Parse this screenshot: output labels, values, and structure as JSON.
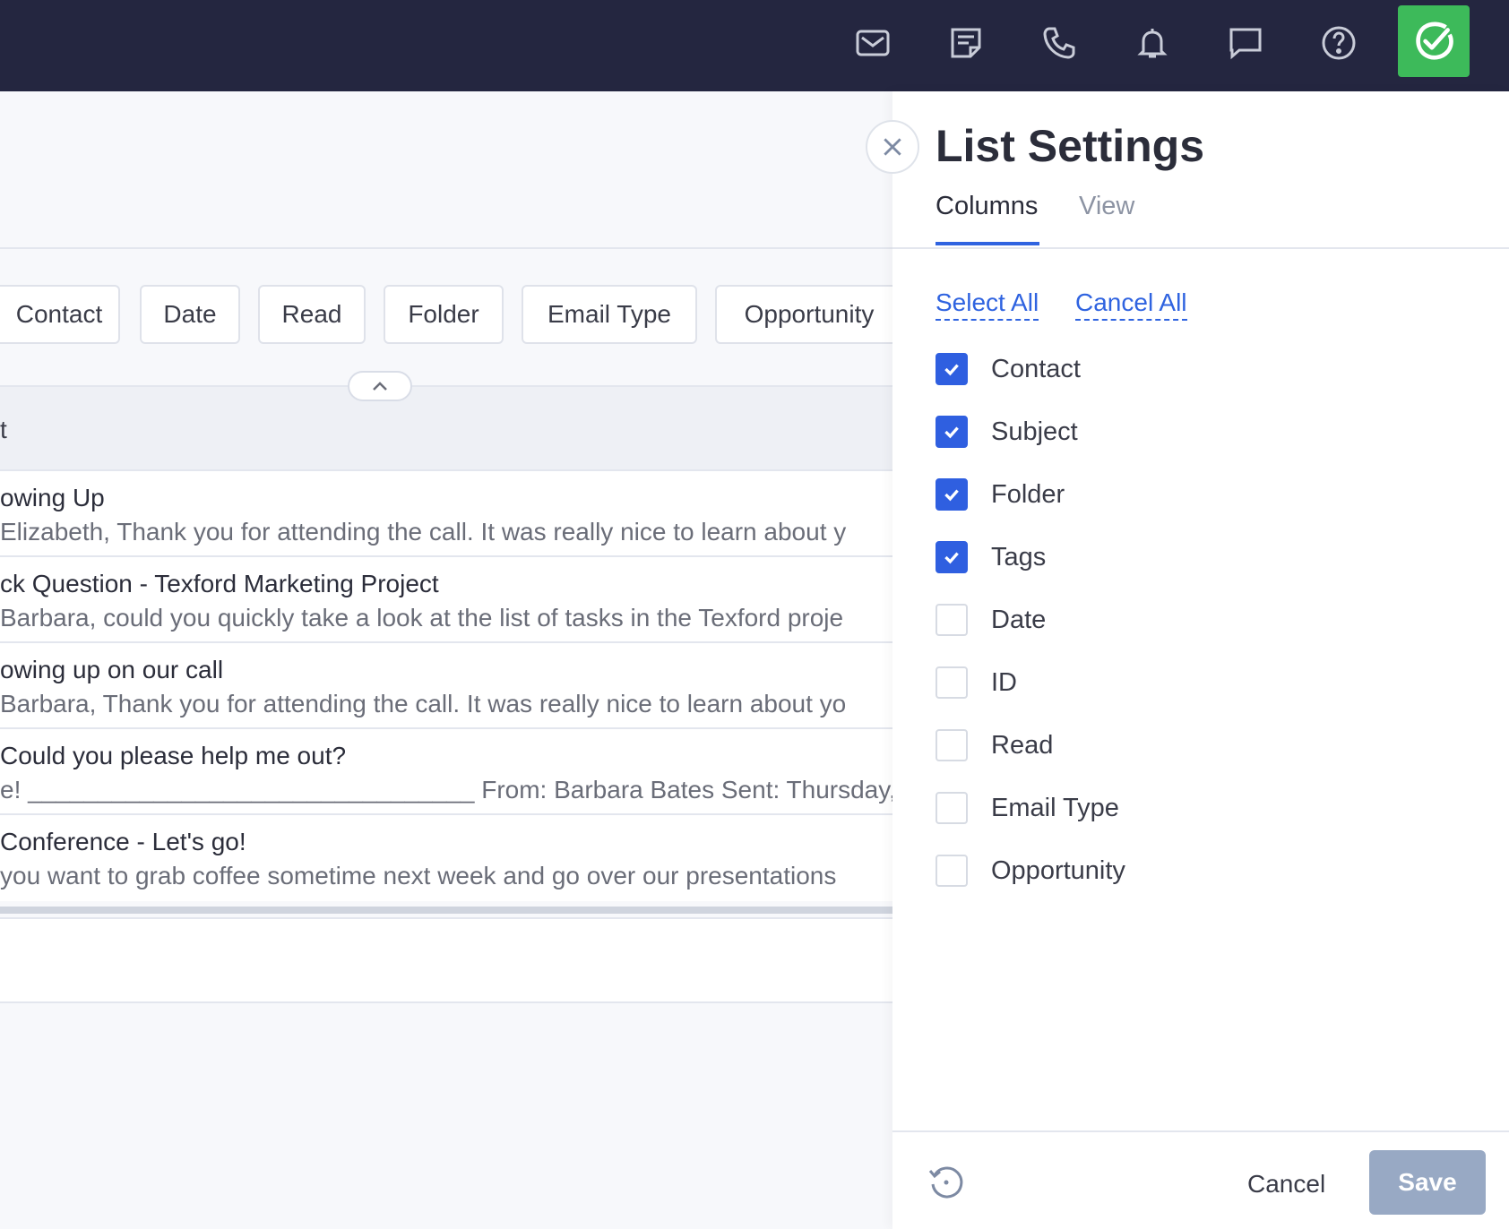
{
  "topbar": {
    "icons": [
      "mail-icon",
      "notes-icon",
      "phone-icon",
      "bell-icon",
      "chat-icon",
      "help-icon",
      "brand-logo"
    ],
    "brand_color": "#3dba5a",
    "bg_color": "#242640"
  },
  "filters": {
    "chips": [
      "Contact",
      "Date",
      "Read",
      "Folder",
      "Email Type",
      "Opportunity"
    ]
  },
  "table": {
    "header": "t",
    "rows": [
      {
        "subject": "owing Up",
        "preview": "Elizabeth, Thank you for attending the call. It was really nice to learn about y"
      },
      {
        "subject": "ck Question - Texford Marketing Project",
        "preview": "Barbara, could you quickly take a look at the list of tasks in the Texford proje"
      },
      {
        "subject": "owing up on our call",
        "preview": "Barbara, Thank you for attending the call. It was really nice to learn about yo"
      },
      {
        "subject": " Could you please help me out?",
        "preview": "e! ________________________________ From: Barbara Bates Sent: Thursday, Augu"
      },
      {
        "subject": " Conference - Let's go!",
        "preview": "you want to grab coffee sometime next week and go over our presentations"
      }
    ]
  },
  "panel": {
    "title": "List Settings",
    "tabs": [
      "Columns",
      "View"
    ],
    "active_tab": "Columns",
    "select_all": "Select All",
    "cancel_all": "Cancel All",
    "columns": [
      {
        "label": "Contact",
        "checked": true
      },
      {
        "label": "Subject",
        "checked": true
      },
      {
        "label": "Folder",
        "checked": true
      },
      {
        "label": "Tags",
        "checked": true
      },
      {
        "label": "Date",
        "checked": false
      },
      {
        "label": "ID",
        "checked": false
      },
      {
        "label": "Read",
        "checked": false
      },
      {
        "label": "Email Type",
        "checked": false
      },
      {
        "label": "Opportunity",
        "checked": false
      }
    ],
    "cancel_label": "Cancel",
    "save_label": "Save",
    "accent_color": "#2f63e0"
  }
}
